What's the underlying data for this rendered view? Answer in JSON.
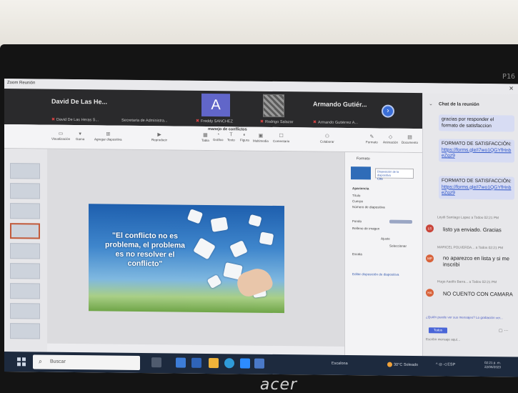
{
  "window": {
    "title": "Zoom Reunión"
  },
  "bezel": {
    "brand": "acer",
    "model": "P16"
  },
  "participants": [
    {
      "display": "David De Las He...",
      "label": "David De Las Heras S..."
    },
    {
      "display": "",
      "label": "Secretaria de Administra..."
    },
    {
      "display": "A",
      "label": "Freddy SANCHEZ"
    },
    {
      "display": "",
      "label": "Rodrigo Salazar"
    },
    {
      "display": "Armando Gutiér...",
      "label": "Armando Gutiérrez A..."
    }
  ],
  "ppt": {
    "doc_title": "manejo de conflictos",
    "ribbon": [
      "Visualización",
      "Gama",
      "Agregar diapositiva",
      "Reproducir",
      "Tabla",
      "Gráfico",
      "Texto",
      "Figura",
      "Multimedia",
      "Comentario",
      "Colaborar",
      "Formato",
      "Animación",
      "Documento"
    ],
    "format_pane": {
      "title": "Formato",
      "layout_label": "Disposición de la diapositiva",
      "layout_value": "Cita",
      "section_apariencia": "Apariencia",
      "titulo": "Título",
      "cuerpo": "Cuerpo",
      "numero": "Número de diapositiva",
      "fondo": "Fondo",
      "relleno": "Relleno de imagen",
      "ajuste": "Ajuste",
      "seleccionar": "Seleccionar",
      "escala": "Escala",
      "editar": "Editar disposición de diapositiva"
    },
    "slide_quote": "\"El conflicto no es problema, el problema es no resolver el conflicto\""
  },
  "chat": {
    "title": "Chat de la reunión",
    "bubbles": [
      {
        "text": "gracias por responder el formato de satisfaccion"
      },
      {
        "text": "FORMATO DE SATISFACCIÓN:",
        "link": "https://forms.gle/i7wo1QGYfHnbeZqz9"
      },
      {
        "text": "FORMATO DE SATISFACCIÓN:",
        "link": "https://forms.gle/i7wo1QGYfHnbeZqz9"
      }
    ],
    "messages": [
      {
        "initials": "LS",
        "meta": "Leydi Santiago Lopez a Todos 02:21 PM",
        "body": "listo ya enviado. Gracias",
        "color": "#c9453a"
      },
      {
        "initials": "MP",
        "meta": "MARICEL POLVERDA... a Todos 02:21 PM",
        "body": "no aparezco en lista y si me inscribi",
        "color": "#d8623a"
      },
      {
        "initials": "HA",
        "meta": "Hugo Aaolfo Barra... a Todos 02:21 PM",
        "body": "NO CUENTO CON CAMARA",
        "color": "#d8623a"
      }
    ],
    "hint": "¿Quién puede ver sus mensajes? Lo grabación ver...",
    "to_button": "Todos",
    "input_placeholder": "Escribir mensaje aquí..."
  },
  "taskbar": {
    "search_placeholder": "Buscar",
    "weather": "Escalona",
    "status": "30°C  Soleado",
    "lang": "ESP",
    "clock_time": "02:21 p. m.",
    "clock_date": "22/06/2023"
  }
}
